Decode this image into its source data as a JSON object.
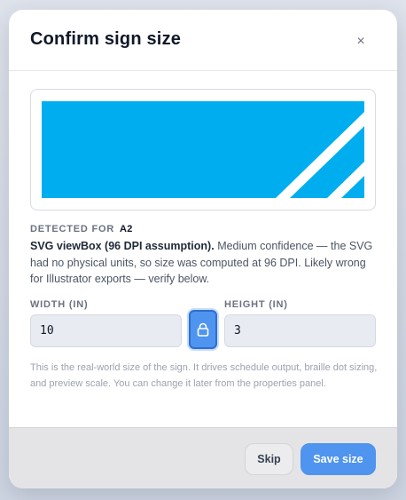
{
  "dialog": {
    "title": "Confirm sign size",
    "close_symbol": "×"
  },
  "preview": {
    "fill_color": "#00aeef",
    "stripe_color": "#ffffff"
  },
  "detection": {
    "label": "DETECTED FOR",
    "code": "A2",
    "method": "SVG viewBox (96 DPI assumption).",
    "note": "Medium confidence — the SVG had no physical units, so size was computed at 96 DPI. Likely wrong for Illustrator exports — verify below."
  },
  "dimensions": {
    "width_label": "WIDTH (IN)",
    "width_value": "10",
    "height_label": "HEIGHT (IN)",
    "height_value": "3",
    "lock_icon": "lock-icon",
    "locked": true
  },
  "help_text": "This is the real-world size of the sign. It drives schedule output, braille dot sizing, and preview scale. You can change it later from the properties panel.",
  "footer": {
    "skip_label": "Skip",
    "save_label": "Save size"
  },
  "colors": {
    "accent": "#4f94ef",
    "preview_blue": "#00aeef"
  }
}
